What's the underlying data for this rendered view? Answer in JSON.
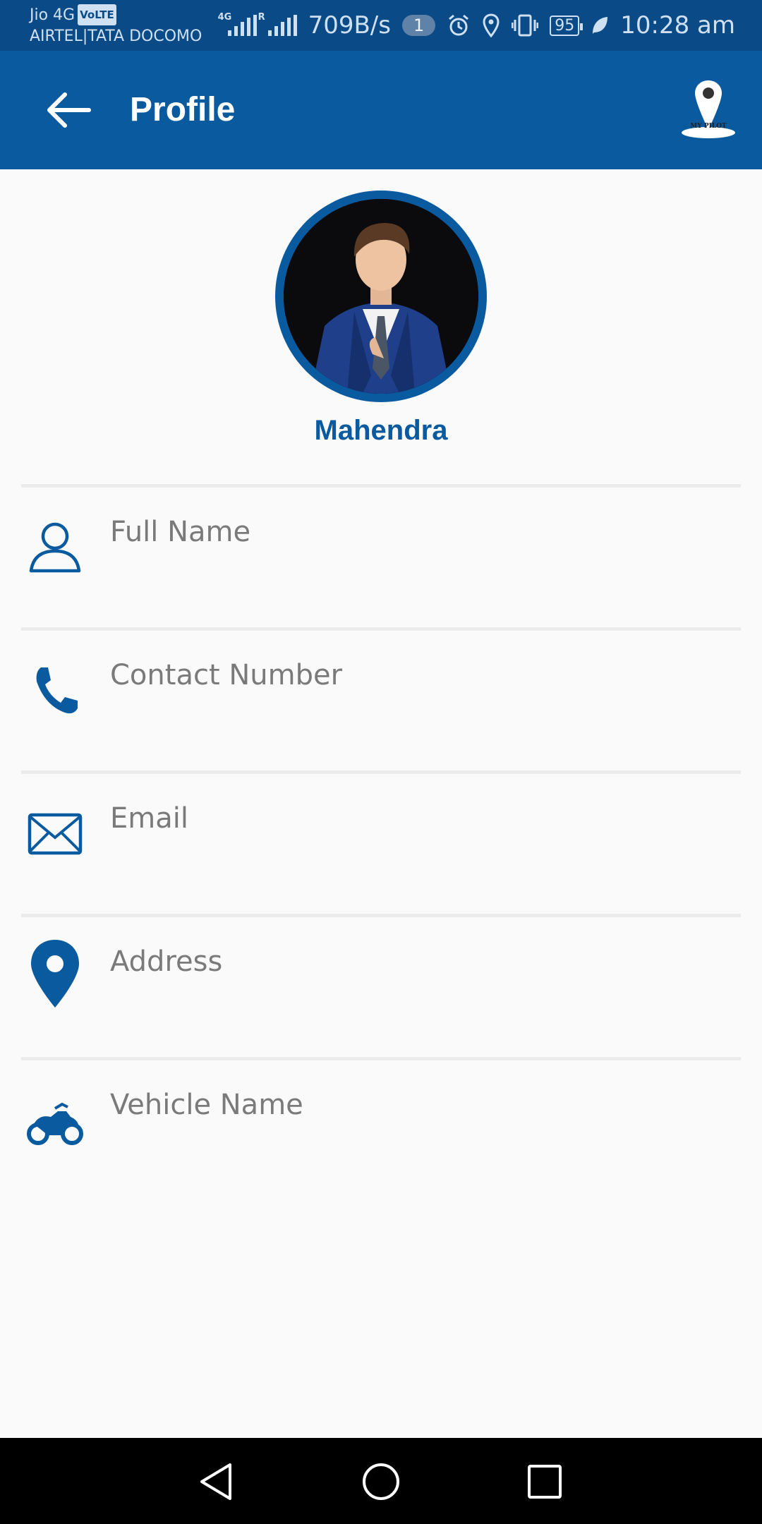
{
  "status_bar": {
    "carrier_primary": "Jio 4G",
    "volte_badge": "VoLTE",
    "carrier_secondary": "AIRTEL|TATA DOCOMO",
    "network_speed": "709B/s",
    "notification_count": "1",
    "battery_level": "95",
    "time": "10:28 am",
    "icons": [
      "signal-4g-icon",
      "signal-roaming-icon",
      "alarm-icon",
      "location-icon",
      "vibrate-icon",
      "battery-icon",
      "leaf-icon"
    ]
  },
  "app_bar": {
    "title": "Profile",
    "back_icon": "arrow-left-icon",
    "logo_text": "MY PILOT"
  },
  "profile": {
    "name": "Mahendra"
  },
  "fields": [
    {
      "label": "Full Name",
      "icon": "person-icon"
    },
    {
      "label": "Contact Number",
      "icon": "phone-icon"
    },
    {
      "label": "Email",
      "icon": "envelope-icon"
    },
    {
      "label": "Address",
      "icon": "location-pin-icon"
    },
    {
      "label": "Vehicle Name",
      "icon": "motorcycle-icon"
    }
  ],
  "nav_bar": {
    "icons": [
      "back-triangle-icon",
      "home-circle-icon",
      "recents-square-icon"
    ]
  },
  "colors": {
    "primary": "#0a5aa0",
    "status_bar": "#0a4a86",
    "label_text": "#7a7a7a",
    "divider": "#ebebeb"
  }
}
